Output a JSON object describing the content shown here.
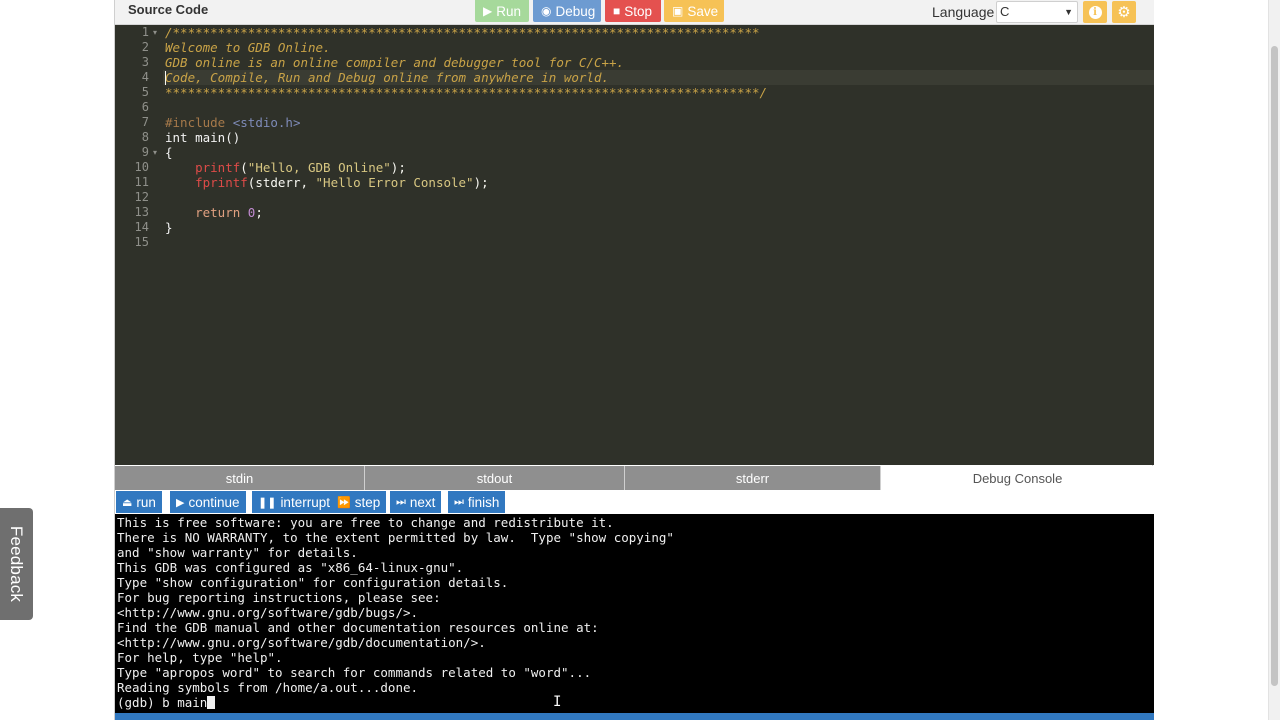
{
  "header": {
    "title": "Source Code",
    "buttons": {
      "run": "Run",
      "debug": "Debug",
      "stop": "Stop",
      "save": "Save"
    },
    "language_label": "Language",
    "language_value": "C"
  },
  "feedback_label": "Feedback",
  "editor": {
    "line_numbers": [
      "1",
      "2",
      "3",
      "4",
      "5",
      "6",
      "7",
      "8",
      "9",
      "10",
      "11",
      "12",
      "13",
      "14",
      "15"
    ],
    "lines": {
      "l1": "/******************************************************************************",
      "l2": "Welcome to GDB Online.",
      "l3": "GDB online is an online compiler and debugger tool for C/C++.",
      "l4": "Code, Compile, Run and Debug online from anywhere in world.",
      "l5": "*******************************************************************************/",
      "l7_pp": "#include",
      "l7_hdr": "<stdio.h>",
      "l8": "int main()",
      "l9": "{",
      "l10_fn": "printf",
      "l10_rest_open": "(",
      "l10_str": "\"Hello, GDB Online\"",
      "l10_rest_close": ");",
      "l11_fn": "fprintf",
      "l11_rest_open": "(stderr, ",
      "l11_str": "\"Hello Error Console\"",
      "l11_rest_close": ");",
      "l13_kw": "return",
      "l13_num": "0",
      "l13_end": ";",
      "l14": "}"
    }
  },
  "tabs": [
    {
      "label": "stdin"
    },
    {
      "label": "stdout"
    },
    {
      "label": "stderr"
    },
    {
      "label": "Debug Console"
    }
  ],
  "debug_buttons": {
    "run": "run",
    "continue": "continue",
    "interrupt": "interrupt",
    "step": "step",
    "next": "next",
    "finish": "finish"
  },
  "console": {
    "lines": [
      "This is free software: you are free to change and redistribute it.",
      "There is NO WARRANTY, to the extent permitted by law.  Type \"show copying\"",
      "and \"show warranty\" for details.",
      "This GDB was configured as \"x86_64-linux-gnu\".",
      "Type \"show configuration\" for configuration details.",
      "For bug reporting instructions, please see:",
      "<http://www.gnu.org/software/gdb/bugs/>.",
      "Find the GDB manual and other documentation resources online at:",
      "<http://www.gnu.org/software/gdb/documentation/>.",
      "For help, type \"help\".",
      "Type \"apropos word\" to search for commands related to \"word\"...",
      "Reading symbols from /home/a.out...done."
    ],
    "prompt_input": "(gdb) b main"
  },
  "colors": {
    "editor_bg": "#2f3129",
    "accent_blue": "#3178c0",
    "run_green": "#a6d99b",
    "stop_red": "#e4514f",
    "save_yellow": "#f6c256"
  }
}
